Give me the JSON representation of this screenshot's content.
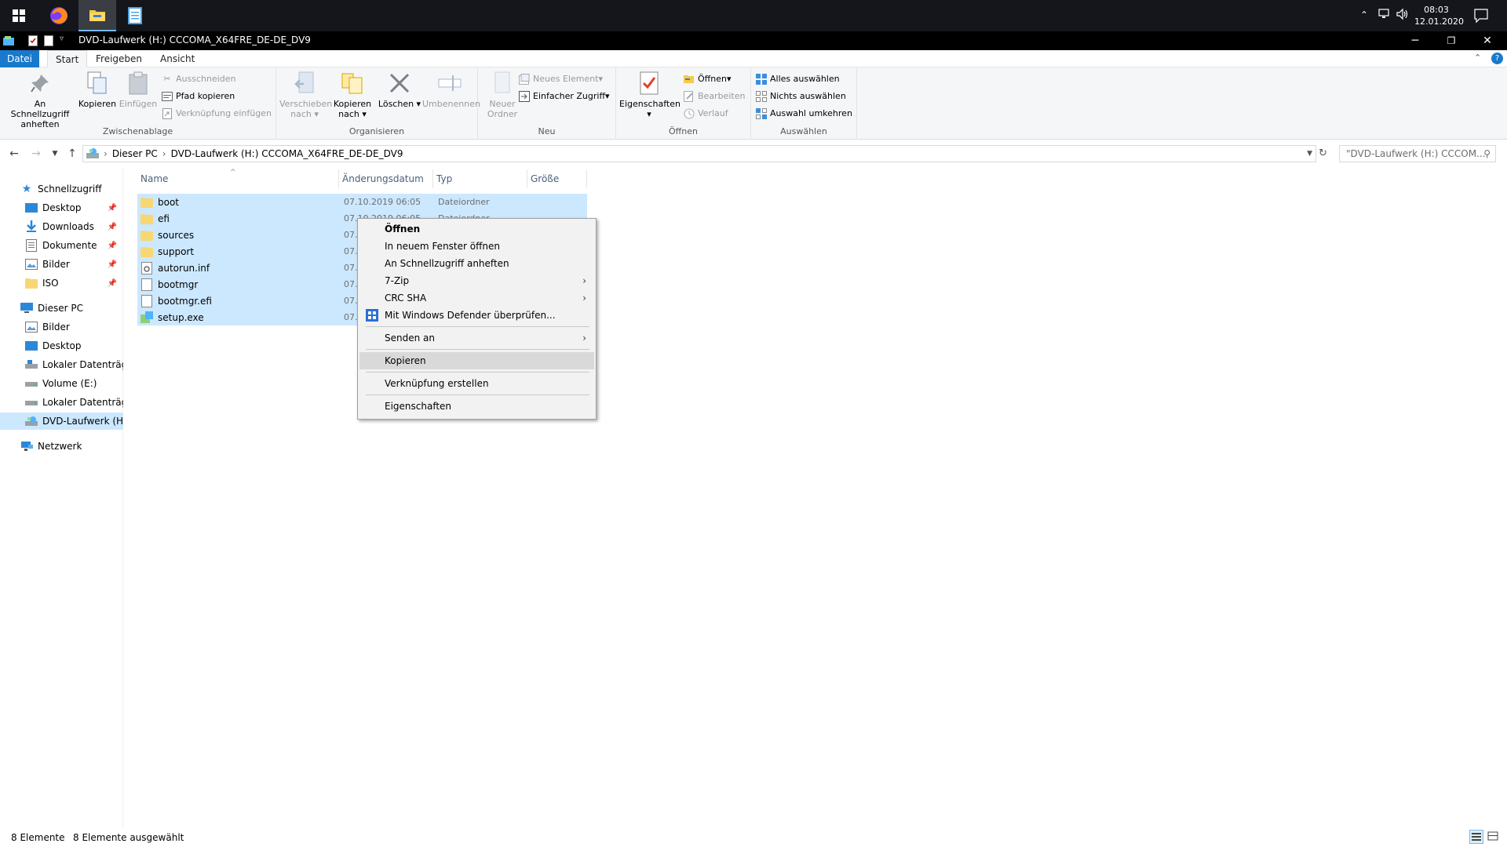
{
  "taskbar": {
    "time": "08:03",
    "date": "12.01.2020"
  },
  "window": {
    "title": "DVD-Laufwerk (H:) CCCOMA_X64FRE_DE-DE_DV9"
  },
  "ribbon_tabs": [
    "Datei",
    "Start",
    "Freigeben",
    "Ansicht"
  ],
  "ribbon": {
    "clipboard": {
      "label": "Zwischenablage",
      "pin": "An Schnellzugriff anheften",
      "copy": "Kopieren",
      "paste": "Einfügen",
      "cut": "Ausschneiden",
      "copy_path": "Pfad kopieren",
      "paste_shortcut": "Verknüpfung einfügen"
    },
    "organize": {
      "label": "Organisieren",
      "move_to": "Verschieben nach",
      "copy_to": "Kopieren nach",
      "delete": "Löschen",
      "rename": "Umbenennen"
    },
    "new": {
      "label": "Neu",
      "new_folder": "Neuer Ordner",
      "new_item": "Neues Element",
      "easy_access": "Einfacher Zugriff"
    },
    "open": {
      "label": "Öffnen",
      "properties": "Eigenschaften",
      "open": "Öffnen",
      "edit": "Bearbeiten",
      "history": "Verlauf"
    },
    "select": {
      "label": "Auswählen",
      "select_all": "Alles auswählen",
      "select_none": "Nichts auswählen",
      "invert": "Auswahl umkehren"
    }
  },
  "address": {
    "crumbs": [
      "Dieser PC",
      "DVD-Laufwerk (H:) CCCOMA_X64FRE_DE-DE_DV9"
    ],
    "search_placeholder": "\"DVD-Laufwerk (H:) CCCOM..."
  },
  "navpane": {
    "quick_access": "Schnellzugriff",
    "quick_items": [
      "Desktop",
      "Downloads",
      "Dokumente",
      "Bilder",
      "ISO"
    ],
    "this_pc": "Dieser PC",
    "pc_items": [
      "Bilder",
      "Desktop",
      "Lokaler Datenträger",
      "Volume (E:)",
      "Lokaler Datenträger",
      "DVD-Laufwerk (H:)"
    ],
    "network": "Netzwerk"
  },
  "columns": [
    "Name",
    "Änderungsdatum",
    "Typ",
    "Größe"
  ],
  "files": [
    {
      "name": "boot",
      "date": "07.10.2019 06:05",
      "type": "Dateiordner",
      "icon": "folder-icon"
    },
    {
      "name": "efi",
      "date": "07.10.2019 06:05",
      "type": "Dateiordner",
      "icon": "folder-icon"
    },
    {
      "name": "sources",
      "date": "07.",
      "type": "",
      "icon": "folder-icon"
    },
    {
      "name": "support",
      "date": "07.",
      "type": "",
      "icon": "folder-icon"
    },
    {
      "name": "autorun.inf",
      "date": "07.",
      "type": "",
      "icon": "settings-file-icon"
    },
    {
      "name": "bootmgr",
      "date": "07.",
      "type": "",
      "icon": "file-icon"
    },
    {
      "name": "bootmgr.efi",
      "date": "07.",
      "type": "",
      "icon": "file-icon"
    },
    {
      "name": "setup.exe",
      "date": "07.",
      "type": "",
      "icon": "setup-icon"
    }
  ],
  "context_menu": {
    "open": "Öffnen",
    "open_new_window": "In neuem Fenster öffnen",
    "pin_quick": "An Schnellzugriff anheften",
    "zip": "7-Zip",
    "crc": "CRC SHA",
    "defender": "Mit Windows Defender überprüfen...",
    "send_to": "Senden an",
    "copy": "Kopieren",
    "create_shortcut": "Verknüpfung erstellen",
    "properties": "Eigenschaften"
  },
  "status": {
    "count": "8 Elemente",
    "selected": "8 Elemente ausgewählt"
  },
  "colors": {
    "accent": "#1979ca",
    "selection": "#cce8ff",
    "folder": "#f7d774"
  }
}
